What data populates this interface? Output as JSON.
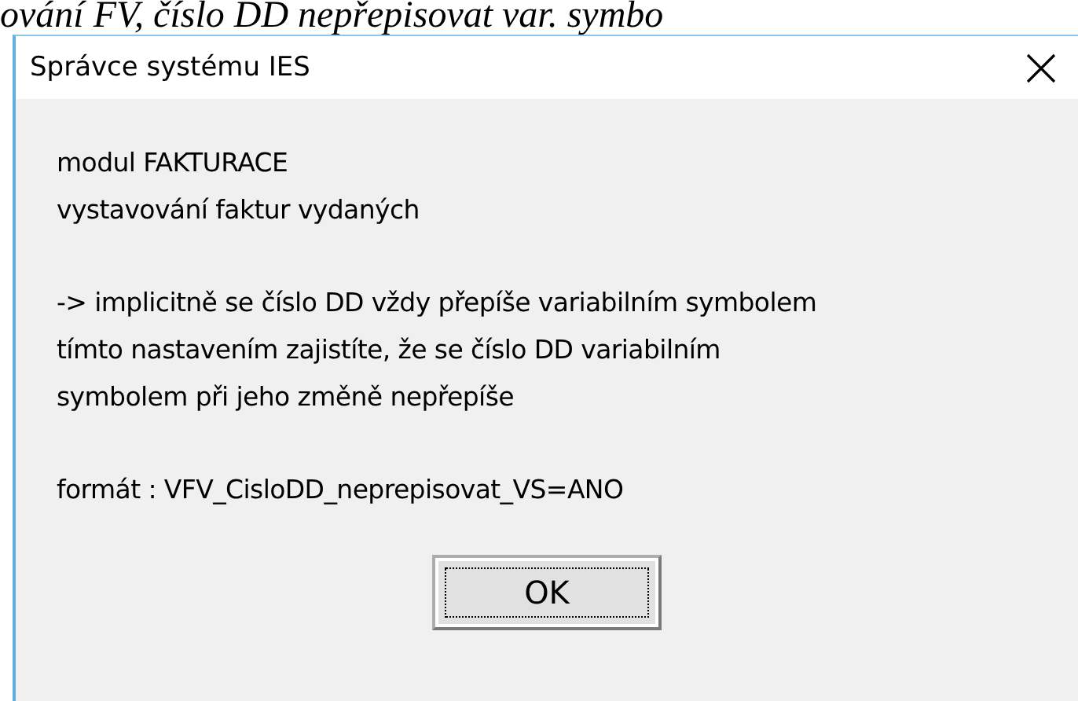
{
  "background_text": "ování FV, číslo DD nepřepisovat var. symbo",
  "dialog": {
    "title": "Správce systému IES",
    "paragraphs": [
      [
        "modul FAKTURACE",
        "vystavování faktur vydaných"
      ],
      [
        "-> implicitně se číslo DD vždy přepíše variabilním symbolem",
        "tímto nastavením zajistíte, že se číslo DD variabilním",
        "symbolem při jeho změně nepřepíše"
      ],
      [
        "formát : VFV_CisloDD_neprepisovat_VS=ANO"
      ]
    ],
    "buttons": [
      "OK"
    ]
  }
}
